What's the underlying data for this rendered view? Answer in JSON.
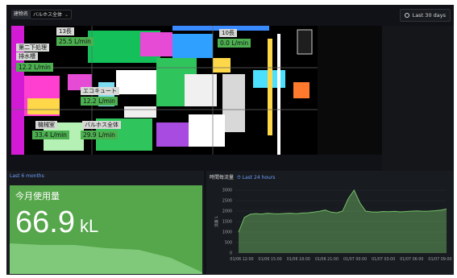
{
  "topbar": {
    "var_label": "建物名",
    "var_value": "バルホス全体",
    "time_range": "Last 30 days"
  },
  "floorplan": {
    "labels": [
      {
        "id": "13bldg",
        "name": "13長",
        "value": "25.5 L/min"
      },
      {
        "id": "10bldg",
        "name": "10長",
        "value": "0.0 L/min"
      },
      {
        "id": "dai2",
        "name": "第二下処理",
        "name2": "排水槽",
        "value": "12.2 L/min"
      },
      {
        "id": "eco",
        "name": "エコキュート",
        "value": "12.2 L/min"
      },
      {
        "id": "kikai",
        "name": "機械室",
        "value": "33.4 L/min"
      },
      {
        "id": "zentai",
        "name": "バルホス全体",
        "value": "29.9 L/min"
      }
    ]
  },
  "stat_panel": {
    "time_range": "Last 6 months",
    "title": "今月使用量",
    "value": "66.9",
    "unit": "kL"
  },
  "chart_panel": {
    "title": "時間毎流量",
    "time_range": "Last 24 hours"
  },
  "chart_data": {
    "type": "area",
    "ylabel": "流量 L",
    "ylim": [
      0,
      3000
    ],
    "yticks": [
      "0",
      "500",
      "1000",
      "1500",
      "2000",
      "2500",
      "3000"
    ],
    "xticks": [
      "01/06 12:00",
      "01/06 15:00",
      "01/06 18:00",
      "01/06 21:00",
      "01/07 00:00",
      "01/07 03:00",
      "01/07 06:00",
      "01/07 09:00"
    ],
    "series": [
      {
        "color": "#73bf69",
        "values": [
          1000,
          1700,
          1850,
          1880,
          1860,
          1900,
          1880,
          1870,
          1890,
          1900,
          1880,
          1910,
          1920,
          1950,
          1990,
          2050,
          1950,
          1920,
          2000,
          2600,
          3000,
          2400,
          2000,
          1960,
          1950,
          1980,
          1970,
          1990,
          1960,
          1980,
          2000,
          2010,
          1990,
          2000,
          2020,
          2050,
          2100
        ]
      }
    ]
  },
  "colors": {
    "panel_bg": "#181b1f",
    "stat_green": "#56a64b",
    "link_blue": "#6e9fff"
  }
}
